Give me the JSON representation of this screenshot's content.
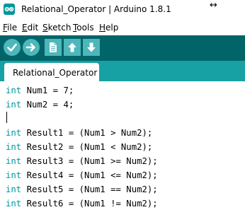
{
  "window": {
    "title": "Relational_Operator | Arduino 1.8.1",
    "app_icon": "arduino-logo-icon",
    "cursor_icon": "resize-horizontal-cursor-icon",
    "cursor_glyph": "↔"
  },
  "menu": [
    {
      "label": "File",
      "mnemonic": "F",
      "rest": "ile"
    },
    {
      "label": "Edit",
      "mnemonic": "E",
      "rest": "dit"
    },
    {
      "label": "Sketch",
      "mnemonic": "S",
      "rest": "ketch"
    },
    {
      "label": "Tools",
      "mnemonic": "T",
      "rest": "ools"
    },
    {
      "label": "Help",
      "mnemonic": "H",
      "rest": "elp"
    }
  ],
  "toolbar": {
    "buttons": [
      {
        "name": "verify",
        "icon": "checkmark-icon"
      },
      {
        "name": "upload",
        "icon": "arrow-right-icon"
      },
      {
        "name": "new",
        "icon": "new-file-icon"
      },
      {
        "name": "open",
        "icon": "arrow-up-icon"
      },
      {
        "name": "save",
        "icon": "arrow-down-icon"
      }
    ]
  },
  "tabs": [
    {
      "label": "Relational_Operator",
      "active": true
    }
  ],
  "editor": {
    "lines": [
      {
        "type": "int",
        "rest": " Num1 = 7;"
      },
      {
        "type": "int",
        "rest": " Num2 = 4;"
      },
      {
        "type": "",
        "rest": ""
      },
      {
        "type": "int",
        "rest": " Result1 = (Num1 > Num2);"
      },
      {
        "type": "int",
        "rest": " Result2 = (Num1 < Num2);"
      },
      {
        "type": "int",
        "rest": " Result3 = (Num1 >= Num2);"
      },
      {
        "type": "int",
        "rest": " Result4 = (Num1 <= Num2);"
      },
      {
        "type": "int",
        "rest": " Result5 = (Num1 == Num2);"
      },
      {
        "type": "int",
        "rest": " Result6 = (Num1 != Num2);"
      }
    ]
  },
  "colors": {
    "toolbar_bg": "#006468",
    "tabbar_bg": "#17a1a5",
    "button_bg": "#4db7bb",
    "keyword": "#00979c"
  }
}
